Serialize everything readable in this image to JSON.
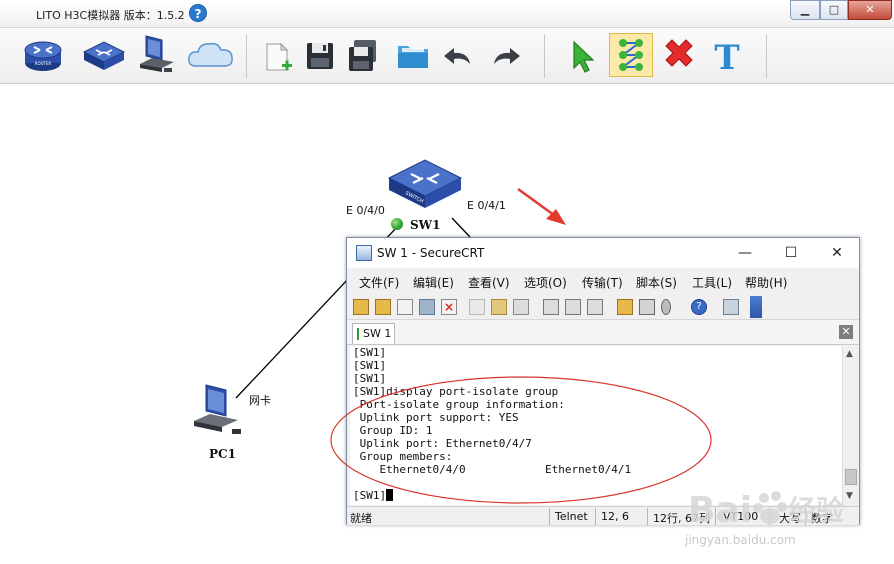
{
  "main_window": {
    "title": "LITO H3C模拟器 版本：1.5.2",
    "help": "?",
    "minimize": "▁",
    "maximize": "□",
    "close": "✕"
  },
  "toolbar": {
    "items": [
      {
        "name": "router",
        "icon": "router-icon"
      },
      {
        "name": "switch",
        "icon": "switch-icon"
      },
      {
        "name": "pc",
        "icon": "pc-icon"
      },
      {
        "name": "cloud",
        "icon": "cloud-icon"
      },
      {
        "name": "new",
        "icon": "new-file-icon"
      },
      {
        "name": "save",
        "icon": "save-icon"
      },
      {
        "name": "save-as",
        "icon": "save-as-icon"
      },
      {
        "name": "open",
        "icon": "open-folder-icon"
      },
      {
        "name": "undo",
        "icon": "undo-icon"
      },
      {
        "name": "redo",
        "icon": "redo-icon"
      },
      {
        "name": "select",
        "icon": "pointer-icon"
      },
      {
        "name": "connect",
        "icon": "connect-icon"
      },
      {
        "name": "delete",
        "icon": "delete-icon"
      },
      {
        "name": "text",
        "icon": "text-tool-icon",
        "label": "T"
      }
    ],
    "active": "connect"
  },
  "topology": {
    "switch_name": "SW1",
    "switch_device_label": "SWITCH",
    "port_left": "E 0/4/0",
    "port_right": "E 0/4/1",
    "pc_name": "PC1",
    "pc_link_label": "网卡"
  },
  "crt": {
    "title": "SW 1 - SecureCRT",
    "minimize": "—",
    "maximize": "☐",
    "close": "✕",
    "menus": [
      "文件(F)",
      "编辑(E)",
      "查看(V)",
      "选项(O)",
      "传输(T)",
      "脚本(S)",
      "工具(L)",
      "帮助(H)"
    ],
    "tab_label": "SW 1",
    "tab_close": "✕",
    "terminal_lines": [
      "[SW1]",
      "[SW1]",
      "[SW1]",
      "[SW1]display port-isolate group",
      " Port-isolate group information:",
      " Uplink port support: YES",
      " Group ID: 1",
      " Uplink port: Ethernet0/4/7",
      " Group members:",
      "    Ethernet0/4/0            Ethernet0/4/1",
      "",
      "[SW1]"
    ],
    "status": {
      "ready": "就绪",
      "protocol": "Telnet",
      "cursor_pos": "12,   6",
      "rows_cols": "12行, 67列",
      "terminal_type": "VT100",
      "caps": "大写",
      "num": "数字"
    }
  },
  "watermark": {
    "brand": "Bai",
    "brand2": "经验",
    "url": "jingyan.baidu.com"
  },
  "colors": {
    "annotation_red": "#d9342b",
    "arrow_red": "#e23b2e",
    "link_status_green": "#2fa033",
    "device_blue": "#2b4fa8"
  }
}
